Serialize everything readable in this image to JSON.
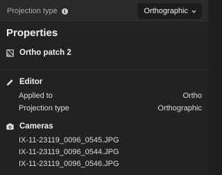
{
  "topbar": {
    "projection_label": "Projection type",
    "projection_value": "Orthographic"
  },
  "panel": {
    "title": "Properties",
    "patch_name": "Ortho patch 2"
  },
  "editor": {
    "heading": "Editor",
    "rows": [
      {
        "label": "Applied to",
        "value": "Ortho"
      },
      {
        "label": "Projection type",
        "value": "Orthographic"
      }
    ]
  },
  "cameras": {
    "heading": "Cameras",
    "files": [
      "IX-11-23119_0096_0545.JPG",
      "IX-11-23119_0096_0544.JPG",
      "IX-11-23119_0096_0546.JPG"
    ]
  },
  "colors": {
    "background": "#222222",
    "topbar": "#2a2a2a",
    "text": "#e8e8e8",
    "muted": "#a8a8a8"
  },
  "icons": [
    "info-icon",
    "chevron-down-icon",
    "patch-icon",
    "pencil-icon",
    "camera-icon"
  ]
}
